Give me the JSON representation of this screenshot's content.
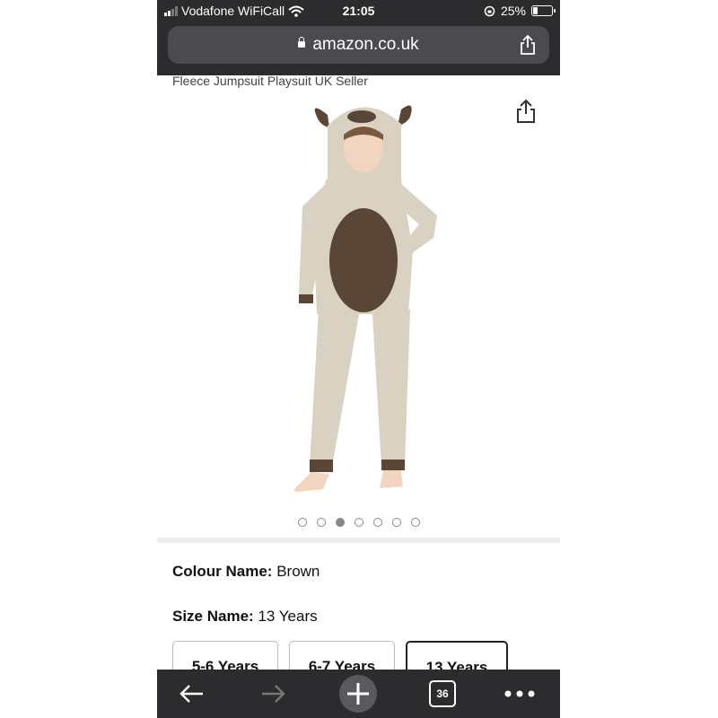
{
  "status_bar": {
    "carrier": "Vodafone WiFiCall",
    "time": "21:05",
    "battery_percent": "25%",
    "battery_level": 0.25
  },
  "browser": {
    "url": "amazon.co.uk",
    "tab_count": "36"
  },
  "product": {
    "title_fragment": "Fleece Jumpsuit Playsuit UK Seller",
    "image_count": 7,
    "active_image_index": 2,
    "colour_label": "Colour Name:",
    "colour_value": "Brown",
    "size_label": "Size Name:",
    "size_value": "13 Years",
    "size_options": [
      {
        "label": "5-6 Years",
        "selected": false
      },
      {
        "label": "6-7 Years",
        "selected": false
      },
      {
        "label": "13 Years",
        "selected": true
      }
    ]
  },
  "icons": {
    "back": "arrow-left-icon",
    "forward": "arrow-right-icon",
    "new_tab": "plus-icon",
    "tabs": "tabs-icon",
    "more": "more-icon",
    "share": "share-icon"
  },
  "colors": {
    "chrome_dark": "#2c2c2e",
    "url_bar": "#4b4b4f",
    "outfit_beige": "#d9d1c1",
    "outfit_brown": "#5a4637"
  }
}
